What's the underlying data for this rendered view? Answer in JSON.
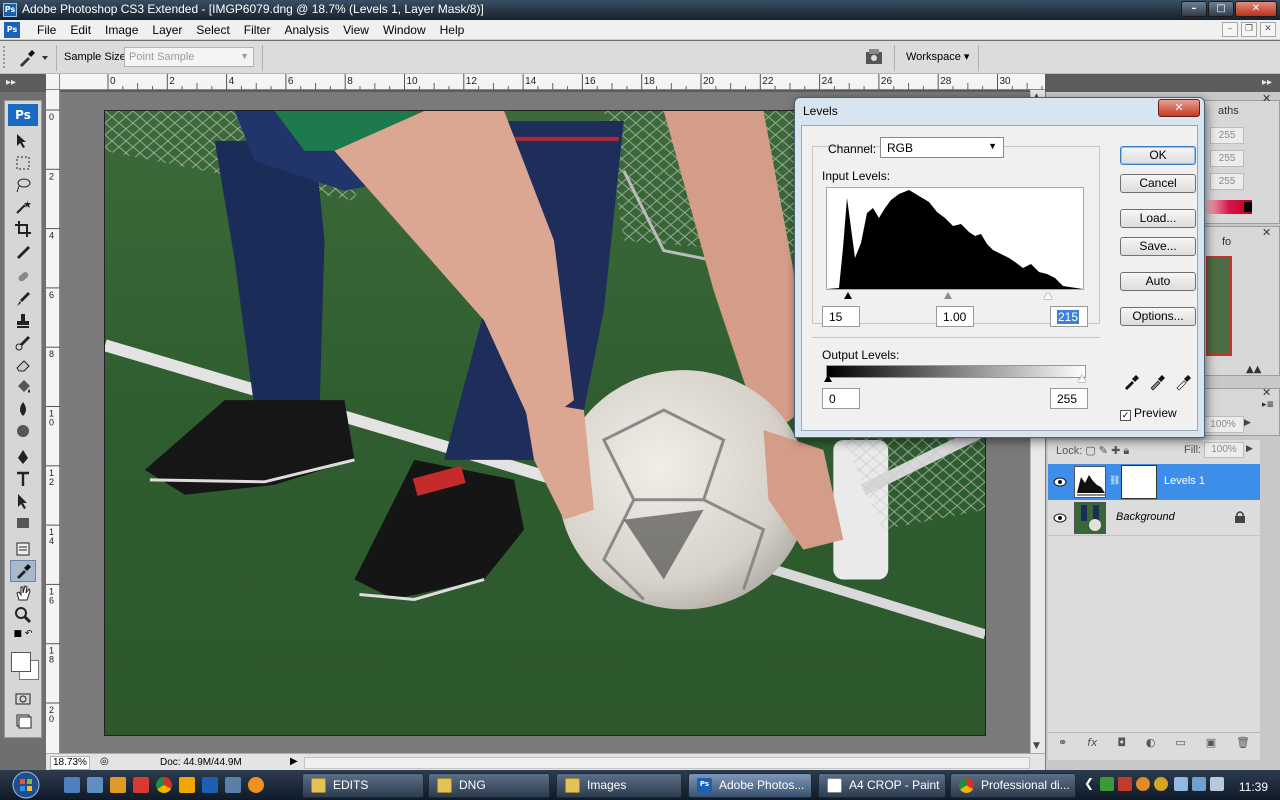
{
  "window": {
    "title": "Adobe Photoshop CS3 Extended - [IMGP6079.dng @ 18.7% (Levels 1, Layer Mask/8)]",
    "app_icon": "Ps",
    "controls": [
      "minimize",
      "maximize",
      "close"
    ]
  },
  "menu": {
    "items": [
      "File",
      "Edit",
      "Image",
      "Layer",
      "Select",
      "Filter",
      "Analysis",
      "View",
      "Window",
      "Help"
    ]
  },
  "options_bar": {
    "sample_size_label": "Sample Size:",
    "sample_size_value": "Point Sample",
    "workspace_label": "Workspace"
  },
  "ruler": {
    "top_labels": [
      "0",
      "2",
      "4",
      "6",
      "8",
      "10",
      "12",
      "14",
      "16",
      "18",
      "20",
      "22",
      "24",
      "26",
      "28",
      "30"
    ],
    "left_labels": [
      "0",
      "2",
      "4",
      "6",
      "8",
      "1 0",
      "1 2",
      "1 4",
      "1 6",
      "1 8",
      "2 0"
    ]
  },
  "toolbox": {
    "logo": "Ps",
    "active_tool": "eyedropper"
  },
  "status_bar": {
    "zoom": "18.73%",
    "doc_info": "Doc: 44.9M/44.9M"
  },
  "panels": {
    "info_tab_fragment": "aths",
    "info_values": [
      "255",
      "255",
      "255"
    ],
    "histogram_tab_fragment": "fo",
    "layers_zoom": "100%",
    "lock_label": "Lock:",
    "fill_label": "Fill:",
    "fill_value": "100%",
    "layers": [
      {
        "name": "Levels 1",
        "selected": true,
        "visible": true,
        "type": "adjustment"
      },
      {
        "name": "Background",
        "selected": false,
        "visible": true,
        "type": "image",
        "locked": true
      }
    ]
  },
  "levels_dialog": {
    "title": "Levels",
    "channel_label": "Channel:",
    "channel_value": "RGB",
    "input_levels_label": "Input Levels:",
    "input_black": "15",
    "input_gamma": "1.00",
    "input_white": "215",
    "output_levels_label": "Output Levels:",
    "output_black": "0",
    "output_white": "255",
    "buttons": {
      "ok": "OK",
      "cancel": "Cancel",
      "load": "Load...",
      "save": "Save...",
      "auto": "Auto",
      "options": "Options..."
    },
    "preview_label": "Preview",
    "preview_checked": true
  },
  "taskbar": {
    "buttons": [
      {
        "label": "EDITS",
        "icon": "folder"
      },
      {
        "label": "DNG",
        "icon": "folder"
      },
      {
        "label": "Images",
        "icon": "folder"
      },
      {
        "label": "Adobe Photos...",
        "icon": "photoshop",
        "active": true
      },
      {
        "label": "A4 CROP - Paint",
        "icon": "paint"
      },
      {
        "label": "Professional di...",
        "icon": "chrome"
      }
    ],
    "clock": "11:39"
  }
}
